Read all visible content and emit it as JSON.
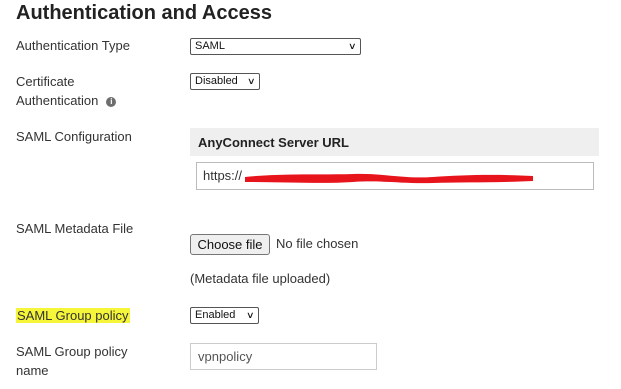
{
  "section_title": "Authentication and Access",
  "auth_type": {
    "label": "Authentication Type",
    "selected": "SAML"
  },
  "cert_auth": {
    "label_line1": "Certificate",
    "label_line2": "Authentication",
    "selected": "Disabled",
    "info_icon": "info-icon"
  },
  "saml_config": {
    "label": "SAML Configuration",
    "panel_title": "AnyConnect Server URL",
    "url_value": "https://"
  },
  "saml_metadata": {
    "label": "SAML Metadata File",
    "choose_file_label": "Choose file",
    "file_status": "No file chosen",
    "uploaded_note": "(Metadata file uploaded)"
  },
  "saml_group_policy": {
    "label": "SAML Group policy",
    "selected": "Enabled",
    "highlight_color": "#f5f53a"
  },
  "saml_group_policy_name": {
    "label_line1": "SAML Group policy",
    "label_line2": "name",
    "value": "vpnpolicy"
  },
  "redaction_color": "#e8141c"
}
